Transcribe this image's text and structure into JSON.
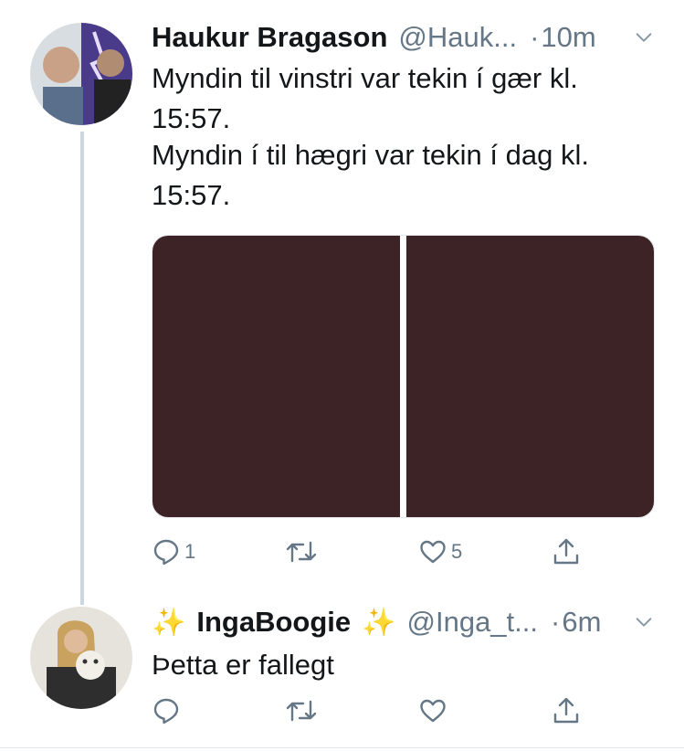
{
  "tweets": [
    {
      "name": "Haukur Bragason",
      "handle": "@Hauk...",
      "separator": "·",
      "time": "10m",
      "text_lines": [
        [
          "Myndin til vinstri var tekin í gær kl.",
          "15:57."
        ],
        [
          "Myndin í til hægri var tekin í dag kl.",
          "15:57."
        ]
      ],
      "media": {
        "photo_left_color": "#3d2326",
        "photo_right_color": "#3d2326"
      },
      "actions": {
        "reply_count": "1",
        "retweet_count": "",
        "like_count": "5"
      }
    },
    {
      "name_prefix": "✨",
      "name": "IngaBoogie",
      "name_suffix": "✨",
      "handle": "@Inga_t...",
      "separator": "·",
      "time": "6m",
      "text": "Þetta er fallegt",
      "actions": {
        "reply_count": "",
        "retweet_count": "",
        "like_count": ""
      }
    }
  ],
  "colors": {
    "text": "#14171a",
    "secondary": "#657786",
    "thread_line": "#ccd6dd",
    "sparkle": "#f5c518"
  },
  "icons": [
    "reply-icon",
    "retweet-icon",
    "like-icon",
    "share-icon",
    "chevron-down-icon"
  ]
}
